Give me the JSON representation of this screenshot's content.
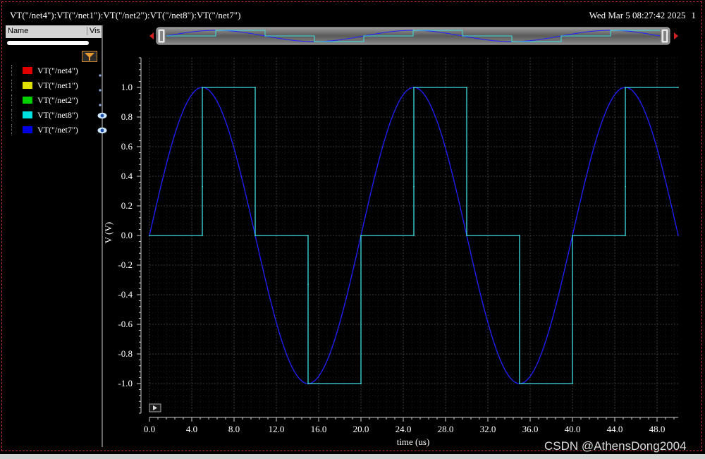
{
  "header": {
    "expression": "VT(\"/net4\"):VT(\"/net1\"):VT(\"/net2\"):VT(\"/net8\"):VT(\"/net7\")",
    "timestamp": "Wed Mar 5 08:27:42 2025",
    "page_number": "1"
  },
  "legend_panel": {
    "col_name": "Name",
    "col_vis": "Vis",
    "items": [
      {
        "label": "VT(\"/net4\")",
        "color": "#e00000",
        "visible": false
      },
      {
        "label": "VT(\"/net1\")",
        "color": "#e0e000",
        "visible": false
      },
      {
        "label": "VT(\"/net2\")",
        "color": "#00d000",
        "visible": false
      },
      {
        "label": "VT(\"/net8\")",
        "color": "#00e0e0",
        "visible": true
      },
      {
        "label": "VT(\"/net7\")",
        "color": "#0000e0",
        "visible": true
      }
    ]
  },
  "watermark": "CSDN @AthensDong2004",
  "colors": {
    "background": "#000000",
    "grid_major": "#3a3a3a",
    "grid_minor": "#1e1e1e",
    "net8": "#40e0e0",
    "net7": "#2020ff"
  },
  "chart_data": {
    "type": "line",
    "xlabel": "time (us)",
    "ylabel": "V (V)",
    "xlim": [
      0,
      50
    ],
    "ylim": [
      -1.2,
      1.2
    ],
    "xticks": [
      "0.0",
      "4.0",
      "8.0",
      "12.0",
      "16.0",
      "20.0",
      "24.0",
      "28.0",
      "32.0",
      "36.0",
      "40.0",
      "44.0",
      "48.0"
    ],
    "yticks": [
      "1.0",
      "0.8",
      "0.6",
      "0.4",
      "0.2",
      "0.0",
      "-0.2",
      "-0.4",
      "-0.6",
      "-0.8",
      "-1.0"
    ],
    "grid": true,
    "series": [
      {
        "name": "VT(\"/net7\")",
        "color": "#2020ff",
        "kind": "sine",
        "amplitude": 1.0,
        "period_us": 20,
        "x": [
          0,
          5,
          10,
          15,
          20,
          25,
          30,
          35,
          40,
          45,
          50
        ],
        "values": [
          0,
          1.0,
          0,
          -1.0,
          0,
          1.0,
          0,
          -1.0,
          0,
          1.0,
          0
        ]
      },
      {
        "name": "VT(\"/net8\")",
        "color": "#40e0e0",
        "kind": "sampled",
        "x": [
          0,
          5,
          5,
          5,
          10,
          10,
          15,
          15,
          15,
          20,
          20,
          25,
          25,
          25,
          30,
          30,
          35,
          35,
          35,
          40,
          40,
          45,
          45,
          45,
          50
        ],
        "values": [
          0,
          0,
          0.33,
          1.0,
          1.0,
          0,
          0,
          -0.33,
          -1.0,
          -1.0,
          0,
          0,
          0.33,
          1.0,
          1.0,
          0,
          0,
          -0.33,
          -1.0,
          -1.0,
          0,
          0,
          0.33,
          1.0,
          1.0
        ]
      }
    ]
  }
}
